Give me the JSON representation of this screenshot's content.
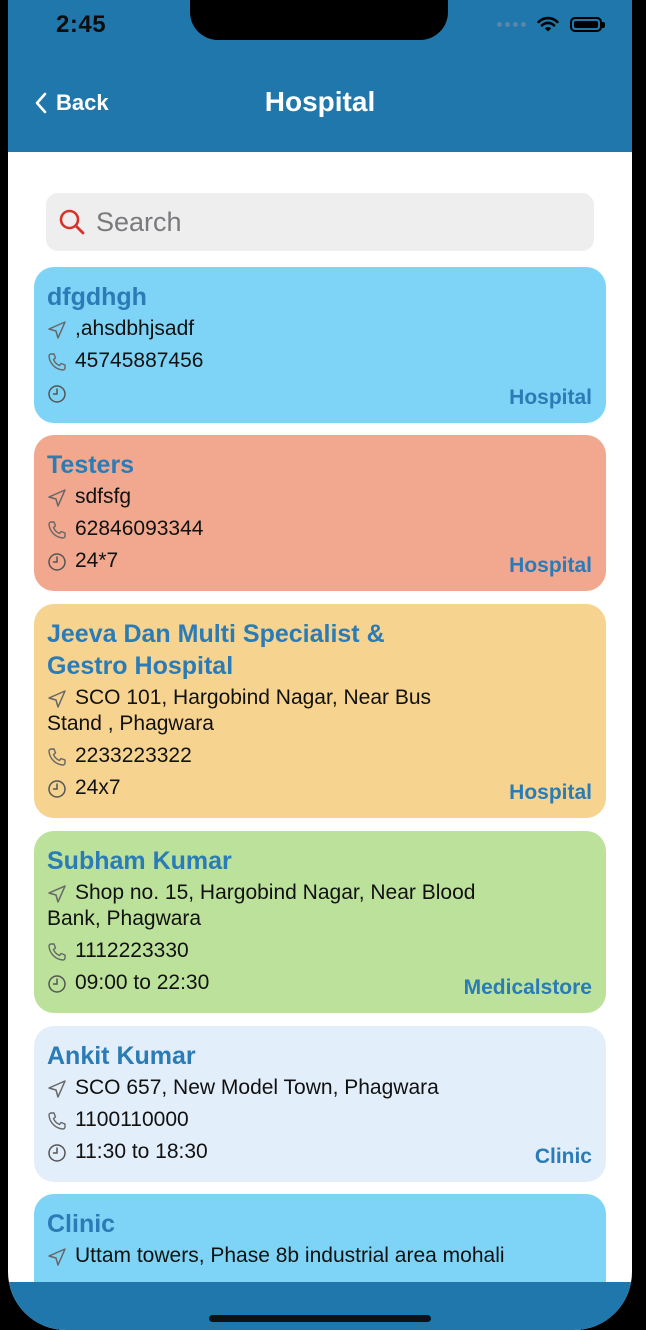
{
  "status_bar": {
    "time": "2:45"
  },
  "nav": {
    "back_label": "Back",
    "title": "Hospital"
  },
  "search": {
    "placeholder": "Search"
  },
  "colors": {
    "primary": "#2077ab",
    "accent_text": "#2a7bb6",
    "card_blue": "#7dd4f6",
    "card_salmon": "#f1a88f",
    "card_yellow": "#f6d38f",
    "card_green": "#bbe19b",
    "card_lightblue": "#e2eef9"
  },
  "cards": [
    {
      "name": "dfgdhgh",
      "address": ",ahsdbhjsadf",
      "phone": "45745887456",
      "hours": "",
      "type": "Hospital"
    },
    {
      "name": "Testers",
      "address": "sdfsfg",
      "phone": "62846093344",
      "hours": "24*7",
      "type": "Hospital"
    },
    {
      "name": "Jeeva Dan Multi Specialist & Gestro Hospital",
      "address": "SCO 101, Hargobind Nagar, Near Bus Stand , Phagwara",
      "phone": "2233223322",
      "hours": "24x7",
      "type": "Hospital"
    },
    {
      "name": "Subham Kumar",
      "address": "Shop no. 15, Hargobind Nagar, Near Blood Bank, Phagwara",
      "phone": "1112223330",
      "hours": "09:00 to 22:30",
      "type": "Medicalstore"
    },
    {
      "name": "Ankit Kumar",
      "address": "SCO 657, New Model Town, Phagwara",
      "phone": "1100110000",
      "hours": "11:30 to 18:30",
      "type": "Clinic"
    },
    {
      "name": "Clinic",
      "address": "Uttam towers, Phase 8b industrial area mohali"
    }
  ]
}
